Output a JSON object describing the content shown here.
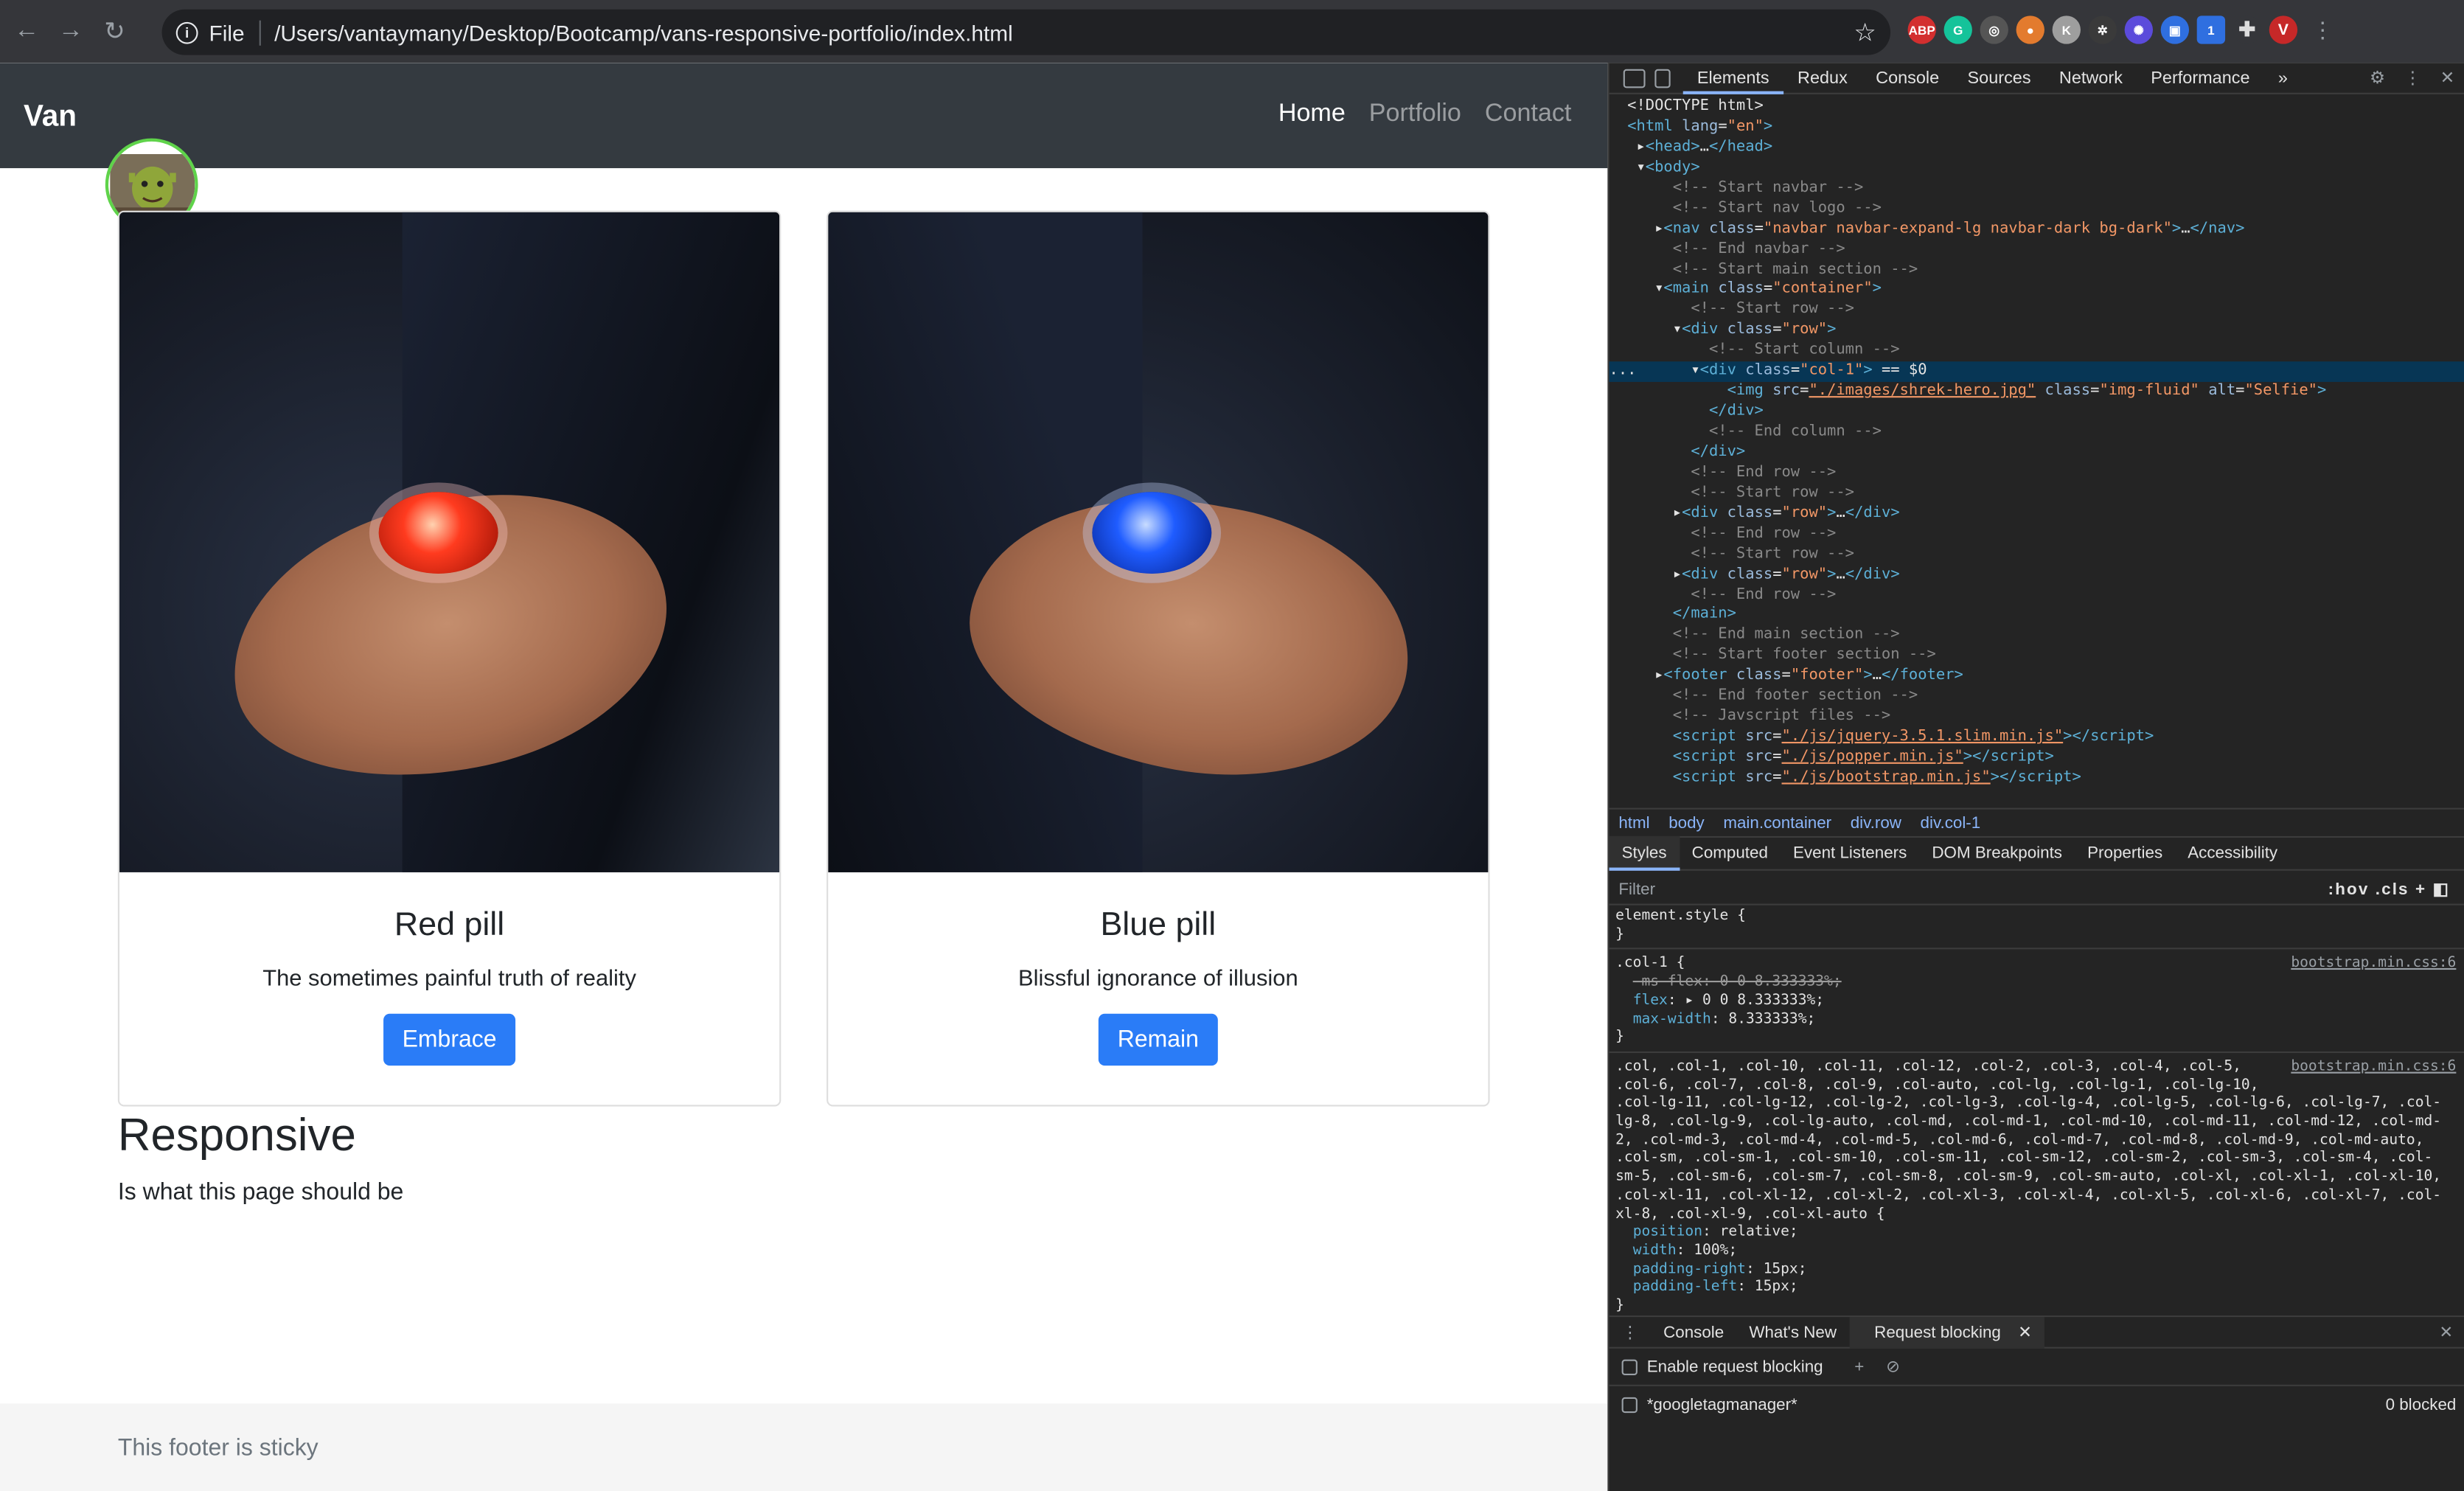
{
  "browser": {
    "address_prefix": "File",
    "url": "/Users/vantaymany/Desktop/Bootcamp/vans-responsive-portfolio/index.html"
  },
  "extensions": [
    "ABP",
    "G",
    "◎",
    "●",
    "K",
    "✲",
    "✺",
    "▣",
    "1",
    "✚",
    "V"
  ],
  "page": {
    "brand": "Van",
    "nav": [
      "Home",
      "Portfolio",
      "Contact"
    ],
    "avatar_alt": "Selfie",
    "cards": [
      {
        "title": "Red pill",
        "text": "The sometimes painful truth of reality",
        "button": "Embrace",
        "pill_color": "#ff3b1f"
      },
      {
        "title": "Blue pill",
        "text": "Blissful ignorance of illusion",
        "button": "Remain",
        "pill_color": "#1f5cff"
      }
    ],
    "heading": "Responsive",
    "subtext": "Is what this page should be",
    "footer": "This footer is sticky"
  },
  "devtools": {
    "tabs": [
      "Elements",
      "Redux",
      "Console",
      "Sources",
      "Network",
      "Performance"
    ],
    "more": "»",
    "breadcrumb": [
      "html",
      "body",
      "main.container",
      "div.row",
      "div.col-1"
    ],
    "subtabs": [
      "Styles",
      "Computed",
      "Event Listeners",
      "DOM Breakpoints",
      "Properties",
      "Accessibility"
    ],
    "filter_placeholder": "Filter",
    "filter_tools": ":hov .cls",
    "drawer_tabs": [
      "Console",
      "What's New",
      "Request blocking"
    ],
    "enable_blocking": "Enable request blocking",
    "pattern": "*googletagmanager*",
    "blocked_count": "0 blocked",
    "source_link": "bootstrap.min.css:6"
  }
}
